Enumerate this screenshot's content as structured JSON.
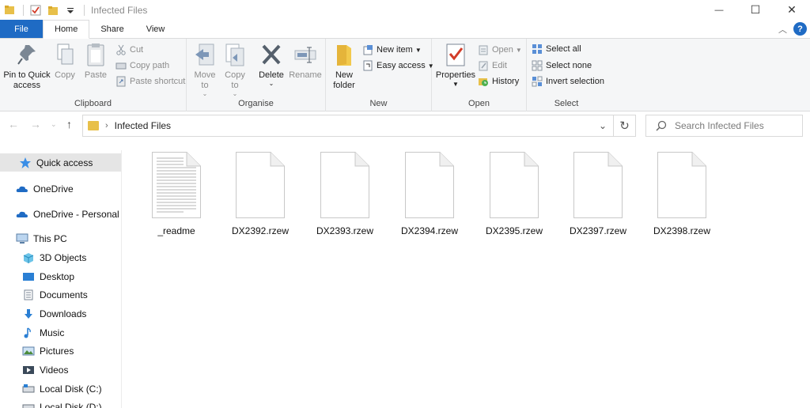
{
  "window": {
    "title": "Infected Files",
    "minimize_glyph": "—",
    "maximize_glyph": "☐",
    "close_glyph": "✕"
  },
  "tabs": [
    {
      "label": "File"
    },
    {
      "label": "Home"
    },
    {
      "label": "Share"
    },
    {
      "label": "View"
    }
  ],
  "help_glyph": "?",
  "ribbon": {
    "clipboard": {
      "label": "Clipboard",
      "pin": "Pin to Quick access",
      "copy": "Copy",
      "paste": "Paste",
      "cut": "Cut",
      "copy_path": "Copy path",
      "paste_shortcut": "Paste shortcut"
    },
    "organise": {
      "label": "Organise",
      "move_to": "Move to",
      "copy_to": "Copy to",
      "delete": "Delete",
      "rename": "Rename"
    },
    "new": {
      "label": "New",
      "new_folder": "New folder",
      "new_item": "New item",
      "easy_access": "Easy access"
    },
    "open": {
      "label": "Open",
      "properties": "Properties",
      "open": "Open",
      "edit": "Edit",
      "history": "History"
    },
    "select": {
      "label": "Select",
      "select_all": "Select all",
      "select_none": "Select none",
      "invert_selection": "Invert selection"
    }
  },
  "address": {
    "path": "Infected Files",
    "search_placeholder": "Search Infected Files"
  },
  "nav": [
    {
      "label": "Quick access",
      "icon": "star-icon"
    },
    {
      "label": "OneDrive",
      "icon": "cloud-icon"
    },
    {
      "label": "OneDrive - Personal",
      "icon": "cloud-icon"
    },
    {
      "label": "This PC",
      "icon": "computer-icon"
    },
    {
      "label": "3D Objects",
      "icon": "cube-icon"
    },
    {
      "label": "Desktop",
      "icon": "desktop-icon"
    },
    {
      "label": "Documents",
      "icon": "documents-icon"
    },
    {
      "label": "Downloads",
      "icon": "download-icon"
    },
    {
      "label": "Music",
      "icon": "music-icon"
    },
    {
      "label": "Pictures",
      "icon": "pictures-icon"
    },
    {
      "label": "Videos",
      "icon": "videos-icon"
    },
    {
      "label": "Local Disk (C:)",
      "icon": "disk-icon"
    },
    {
      "label": "Local Disk (D:)",
      "icon": "disk-icon"
    }
  ],
  "files": [
    {
      "name": "_readme",
      "type": "text"
    },
    {
      "name": "DX2392.rzew",
      "type": "blank"
    },
    {
      "name": "DX2393.rzew",
      "type": "blank"
    },
    {
      "name": "DX2394.rzew",
      "type": "blank"
    },
    {
      "name": "DX2395.rzew",
      "type": "blank"
    },
    {
      "name": "DX2397.rzew",
      "type": "blank"
    },
    {
      "name": "DX2398.rzew",
      "type": "blank"
    }
  ],
  "colors": {
    "accent": "#1f6bc4",
    "folder": "#e8c04a",
    "selected_nav": "#e5e5e5"
  }
}
